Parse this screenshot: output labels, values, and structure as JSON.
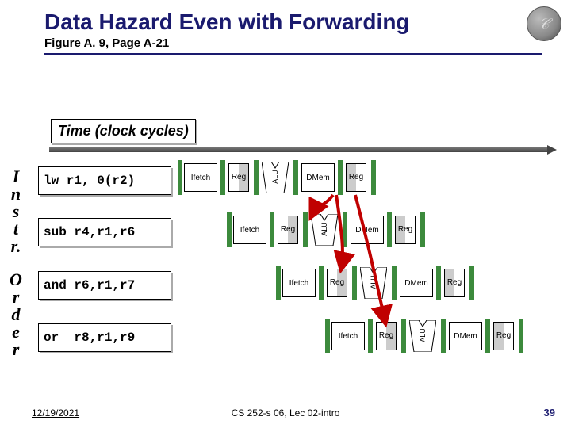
{
  "title": "Data Hazard Even with Forwarding",
  "subtitle": "Figure A. 9, Page A-21",
  "time_label": "Time (clock cycles)",
  "side_label_top": "I\nn\ns\nt\nr.",
  "side_label_bottom": "O\nr\nd\ne\nr",
  "instructions": {
    "i0": "lw r1, 0(r2)",
    "i1": "sub r4,r1,r6",
    "i2": "and r6,r1,r7",
    "i3": "or  r8,r1,r9"
  },
  "stage_labels": {
    "ifetch": "Ifetch",
    "reg": "Reg",
    "alu": "ALU",
    "dmem": "DMem"
  },
  "footer": {
    "date": "12/19/2021",
    "center": "CS 252-s 06, Lec 02-intro",
    "page": "39"
  },
  "logo_glyph": "𝒞"
}
